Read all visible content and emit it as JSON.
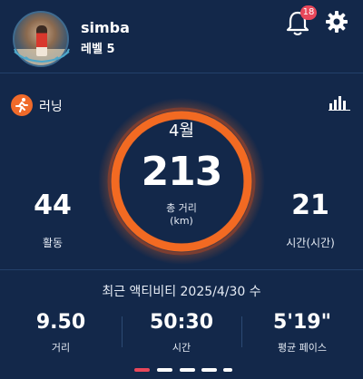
{
  "header": {
    "username": "simba",
    "level": "레벨 5",
    "notification_count": "18"
  },
  "activity": {
    "type_label": "러닝",
    "month": "4월",
    "distance": "213",
    "distance_label": "총 거리",
    "distance_unit": "(km)",
    "activities_count": "44",
    "activities_label": "활동",
    "hours_count": "21",
    "hours_label": "시간(시간)"
  },
  "recent": {
    "title": "최근 액티비티 2025/4/30 수",
    "distance_value": "9.50",
    "distance_label": "거리",
    "time_value": "50:30",
    "time_label": "시간",
    "pace_value": "5'19\"",
    "pace_label": "평균 페이스"
  },
  "pager": {
    "count": 5,
    "active": 0
  },
  "colors": {
    "background": "#13284a",
    "ring_orange": "#f26a22",
    "badge_red": "#e8475a",
    "run_icon": "#f06a2a"
  },
  "icons": [
    "avatar",
    "bell-icon",
    "gear-icon",
    "run-icon",
    "stats-icon"
  ]
}
